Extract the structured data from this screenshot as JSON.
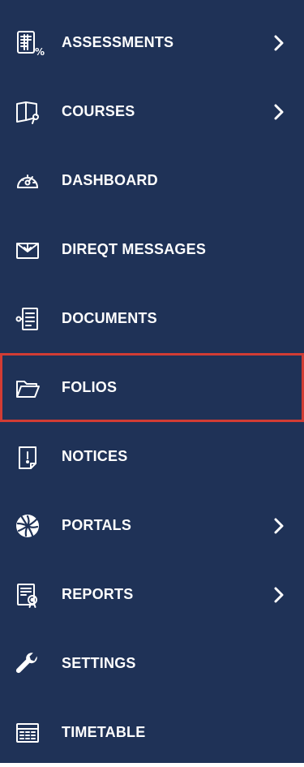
{
  "sidebar": {
    "colors": {
      "background": "#1f3257",
      "text": "#ffffff",
      "active_outline": "#d13c34"
    },
    "items": [
      {
        "label": "ASSESSMENTS",
        "icon": "assessments-icon",
        "has_chevron": true,
        "active": false
      },
      {
        "label": "COURSES",
        "icon": "courses-icon",
        "has_chevron": true,
        "active": false
      },
      {
        "label": "DASHBOARD",
        "icon": "dashboard-icon",
        "has_chevron": false,
        "active": false
      },
      {
        "label": "DIREQT MESSAGES",
        "icon": "messages-icon",
        "has_chevron": false,
        "active": false
      },
      {
        "label": "DOCUMENTS",
        "icon": "documents-icon",
        "has_chevron": false,
        "active": false
      },
      {
        "label": "FOLIOS",
        "icon": "folder-icon",
        "has_chevron": false,
        "active": true
      },
      {
        "label": "NOTICES",
        "icon": "notices-icon",
        "has_chevron": false,
        "active": false
      },
      {
        "label": "PORTALS",
        "icon": "portals-icon",
        "has_chevron": true,
        "active": false
      },
      {
        "label": "REPORTS",
        "icon": "reports-icon",
        "has_chevron": true,
        "active": false
      },
      {
        "label": "SETTINGS",
        "icon": "settings-icon",
        "has_chevron": false,
        "active": false
      },
      {
        "label": "TIMETABLE",
        "icon": "timetable-icon",
        "has_chevron": false,
        "active": false
      }
    ]
  }
}
